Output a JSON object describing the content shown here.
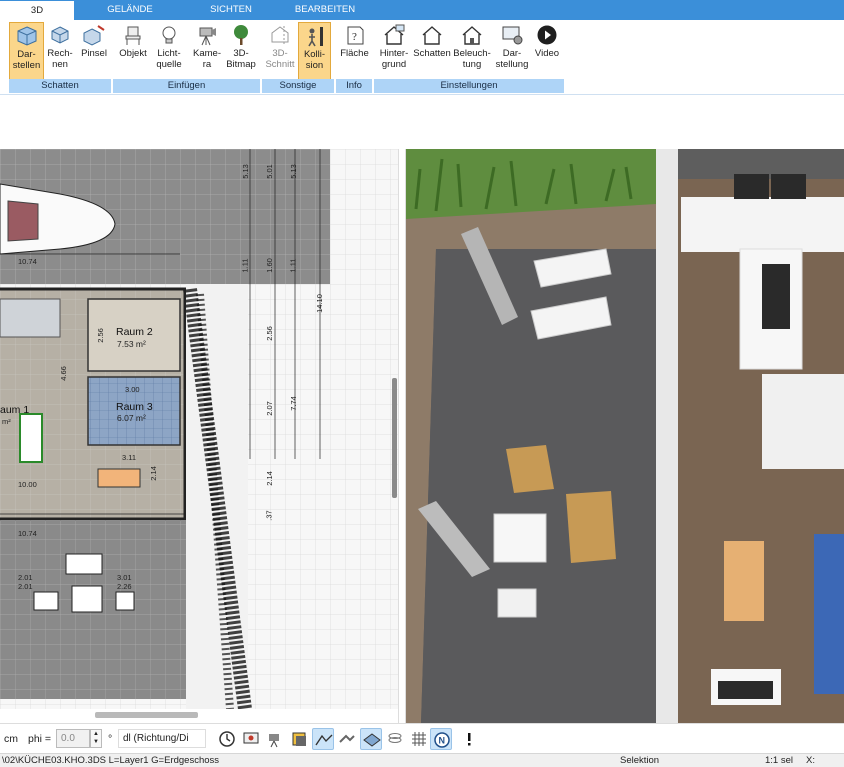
{
  "tabs": {
    "t0": "3D",
    "t1": "GELÄNDE",
    "t2": "SICHTEN",
    "t3": "BEARBEITEN"
  },
  "ribbon": {
    "buttons": [
      {
        "label": "Dar-\nstellen",
        "icon": "cube-icon"
      },
      {
        "label": "Rech-\nnen",
        "icon": "cube-render-icon"
      },
      {
        "label": "Pinsel",
        "icon": "brush-cube-icon"
      },
      {
        "label": "Objekt",
        "icon": "chair-icon"
      },
      {
        "label": "Licht-\nquelle",
        "icon": "lightbulb-icon"
      },
      {
        "label": "Kame-\nra",
        "icon": "camera-icon"
      },
      {
        "label": "3D-\nBitmap",
        "icon": "tree-icon"
      },
      {
        "label": "3D-\nSchnitt",
        "icon": "section-icon"
      },
      {
        "label": "Kolli-\nsion",
        "icon": "collision-icon"
      },
      {
        "label": "Fläche",
        "icon": "area-info-icon"
      },
      {
        "label": "Hinter-\ngrund",
        "icon": "house-bg-icon"
      },
      {
        "label": "Schatten",
        "icon": "house-shadow-icon"
      },
      {
        "label": "Beleuch-\ntung",
        "icon": "house-light-icon"
      },
      {
        "label": "Dar-\nstellung",
        "icon": "display-settings-icon"
      },
      {
        "label": "Video",
        "icon": "play-icon"
      }
    ],
    "groups": {
      "g0": "Schatten",
      "g1": "Einfügen",
      "g2": "Sonstige",
      "g3": "Info",
      "g4": "Einstellungen"
    }
  },
  "plan": {
    "rooms": {
      "r2_name": "Raum 2",
      "r2_area": "7.53 m²",
      "r3_name": "Raum 3",
      "r3_area": "6.07 m²",
      "r1_name": "aum 1",
      "r1_area": "m²"
    },
    "dims": {
      "d1": "10.74",
      "d2": "10.74",
      "d3": "10.00",
      "d4": "4.66",
      "d5": "2.56",
      "d6": "3.00",
      "d7": "3.11",
      "d8": "2.14",
      "d9": "2.01",
      "d10": "3.01",
      "d11": "2.01",
      "d12": "2.26",
      "d13": "5.13",
      "d14": "5.01",
      "d15": "5.13",
      "d16": "1.11",
      "d17": "1.60",
      "d18": "1.11",
      "d19": "2.56",
      "d20": "7.74",
      "d21": "14.10",
      "d22": "2.07",
      "d23": "2.14",
      "d24": ".37"
    }
  },
  "toolbar": {
    "unit": "cm",
    "phi_label": "phi =",
    "phi_value": "0.0",
    "degree": "°",
    "direction": "dl (Richtung/Di"
  },
  "status": {
    "file": "\\02\\KÜCHE03.KHO.3DS L=Layer1 G=Erdgeschoss",
    "mode": "Selektion",
    "scale": "1:1 sel",
    "x": "X:"
  },
  "colors": {
    "ribbon_tab_bg": "#3b8fd9",
    "group_bg": "#aed4f7",
    "active_btn": "#fbd68b"
  }
}
